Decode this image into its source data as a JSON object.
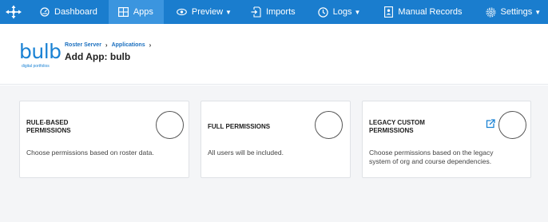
{
  "nav": {
    "items": [
      {
        "label": "Dashboard",
        "icon": "dashboard-icon"
      },
      {
        "label": "Apps",
        "icon": "apps-grid-icon",
        "active": true
      },
      {
        "label": "Preview",
        "icon": "eye-icon",
        "dropdown": true
      },
      {
        "label": "Imports",
        "icon": "import-file-icon"
      },
      {
        "label": "Logs",
        "icon": "clock-icon",
        "dropdown": true
      },
      {
        "label": "Manual Records",
        "icon": "document-user-icon"
      },
      {
        "label": "Settings",
        "icon": "gear-icon",
        "dropdown": true
      }
    ],
    "colors": {
      "bar": "#1a7dce",
      "active": "#3b95df"
    }
  },
  "header": {
    "brand": {
      "word": "bulb",
      "tagline": "digital portfolios"
    },
    "breadcrumb": [
      "Roster Server",
      "Applications"
    ],
    "title": "Add App: bulb"
  },
  "cards": [
    {
      "title_line1": "RULE-BASED",
      "title_line2": "PERMISSIONS",
      "description_line1": "Choose permissions based on roster data.",
      "description_line2": ""
    },
    {
      "title_line1": "FULL PERMISSIONS",
      "title_line2": "",
      "description_line1": "All users will be included.",
      "description_line2": ""
    },
    {
      "title_line1": "LEGACY CUSTOM",
      "title_line2": "PERMISSIONS",
      "description_line1": "Choose permissions based on the legacy",
      "description_line2": "system of org and course dependencies.",
      "has_external_link": true
    }
  ]
}
